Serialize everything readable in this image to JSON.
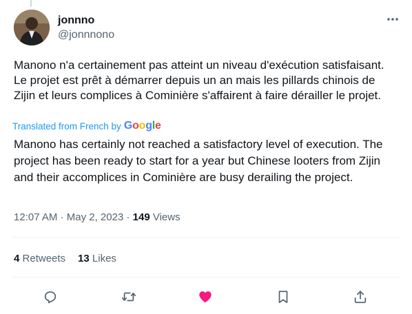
{
  "author": {
    "display_name": "jonnno",
    "handle": "@jonnnono"
  },
  "tweet": {
    "text": "Manono n'a certainement pas atteint un niveau d'exécution satisfaisant. Le projet est prêt à démarrer depuis un an mais les pillards chinois de Zijin et leurs complices à Cominière s'affairent à faire dérailler le projet.",
    "translated_from": "Translated from French by",
    "translator": "Google",
    "translation": "Manono has certainly not reached a satisfactory level of execution. The project has been ready to start for a year but Chinese looters from Zijin and their accomplices in Cominière are busy derailing the project."
  },
  "meta": {
    "time": "12:07 AM",
    "separator": "·",
    "date": "May 2, 2023",
    "views_count": "149",
    "views_label": "Views"
  },
  "stats": {
    "retweets_count": "4",
    "retweets_label": "Retweets",
    "likes_count": "13",
    "likes_label": "Likes"
  },
  "colors": {
    "like_active": "#f91880",
    "icon_default": "#536471",
    "link": "#1d9bf0"
  },
  "icons": {
    "more": "more-icon",
    "reply": "reply-icon",
    "retweet": "retweet-icon",
    "like": "heart-icon",
    "bookmark": "bookmark-icon",
    "share": "share-icon"
  }
}
